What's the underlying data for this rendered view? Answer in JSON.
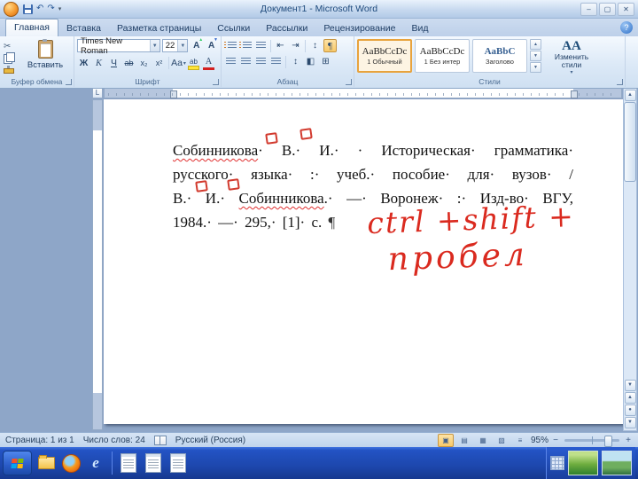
{
  "window": {
    "title": "Документ1 - Microsoft Word",
    "minimize": "–",
    "maximize": "▢",
    "close": "✕"
  },
  "tabs": {
    "items": [
      {
        "label": "Главная",
        "active": true
      },
      {
        "label": "Вставка",
        "active": false
      },
      {
        "label": "Разметка страницы",
        "active": false
      },
      {
        "label": "Ссылки",
        "active": false
      },
      {
        "label": "Рассылки",
        "active": false
      },
      {
        "label": "Рецензирование",
        "active": false
      },
      {
        "label": "Вид",
        "active": false
      }
    ],
    "help": "?"
  },
  "ribbon": {
    "clipboard": {
      "label": "Буфер обмена",
      "paste": "Вставить"
    },
    "font": {
      "label": "Шрифт",
      "name": "Times New Roman",
      "size": "22",
      "bold": "Ж",
      "italic": "К",
      "underline": "Ч",
      "strike": "ab",
      "sub": "x₂",
      "sup": "x²",
      "case": "Aa",
      "grow": "А",
      "shrink": "А",
      "highlight": "ab",
      "color_letter": "А"
    },
    "paragraph": {
      "label": "Абзац",
      "pilcrow": "¶"
    },
    "styles": {
      "label": "Стили",
      "icon_letters": "АА",
      "change_line1": "Изменить",
      "change_line2": "стили",
      "items": [
        {
          "preview": "AaBbCcDc",
          "name": "1 Обычный"
        },
        {
          "preview": "AaBbCcDc",
          "name": "1 Без интер"
        },
        {
          "preview": "AaBbC",
          "name": "Заголово"
        }
      ]
    }
  },
  "ruler": {
    "tab_selector": "L"
  },
  "document": {
    "l1a": "Собинникова",
    "l1b": "· В.· И.· · Историческая· грамматика·",
    "l2": "русского· языка· :· учеб.· пособие· для· вузов· /",
    "l3a": "В.· И.· ",
    "l3b": "Собинникова",
    "l3c": ".· —· Воронеж· :· Изд-во· ВГУ,",
    "l4": "1984.· —· 295,· [1]· с.",
    "pilcrow": "¶",
    "annotation1": "ctrl +shift +",
    "annotation2": "пробел"
  },
  "status": {
    "page": "Страница: 1 из 1",
    "words": "Число слов: 24",
    "language": "Русский (Россия)",
    "zoom": "95%",
    "zoom_minus": "−",
    "zoom_plus": "+"
  },
  "taskbar": {
    "ie_glyph": "e"
  }
}
